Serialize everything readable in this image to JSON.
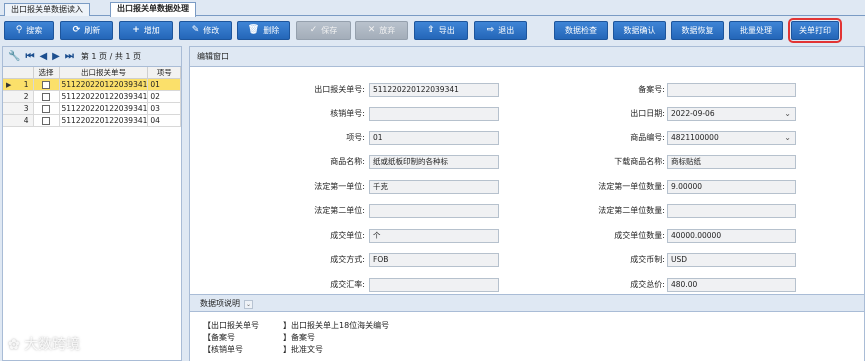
{
  "tabs": [
    {
      "label": "出口报关单数据读入"
    },
    {
      "label": "出口报关单数据处理"
    }
  ],
  "toolbar": {
    "search": {
      "label": "搜索",
      "icon": "search-icon"
    },
    "refresh": {
      "label": "刷新",
      "icon": "refresh-icon"
    },
    "add": {
      "label": "增加",
      "icon": "plus-icon"
    },
    "edit": {
      "label": "修改",
      "icon": "edit-icon"
    },
    "delete": {
      "label": "删除",
      "icon": "trash-icon"
    },
    "save": {
      "label": "保存",
      "icon": "check-icon"
    },
    "cancel": {
      "label": "放弃",
      "icon": "close-icon"
    },
    "export": {
      "label": "导出",
      "icon": "upload-icon"
    },
    "exit": {
      "label": "退出",
      "icon": "exit-icon"
    },
    "data_check": {
      "label": "数据检查"
    },
    "data_confirm": {
      "label": "数据确认"
    },
    "data_restore": {
      "label": "数据恢复"
    },
    "batch": {
      "label": "批量处理"
    },
    "print": {
      "label": "关单打印"
    }
  },
  "pager": {
    "info": "第 1 页 / 共 1 页"
  },
  "grid": {
    "headers": {
      "select": "选择",
      "no": "出口报关单号",
      "seq": "项号"
    },
    "rows": [
      {
        "rn": "1",
        "no": "511220220122039341",
        "seq": "01"
      },
      {
        "rn": "2",
        "no": "511220220122039341",
        "seq": "02"
      },
      {
        "rn": "3",
        "no": "511220220122039341",
        "seq": "03"
      },
      {
        "rn": "4",
        "no": "511220220122039341",
        "seq": "04"
      }
    ]
  },
  "edit_panel": {
    "title": "编辑窗口"
  },
  "form": {
    "decl_no": {
      "label": "出口报关单号:",
      "value": "511220220122039341"
    },
    "record_no": {
      "label": "备案号:",
      "value": ""
    },
    "verify_no": {
      "label": "核销单号:",
      "value": ""
    },
    "export_date": {
      "label": "出口日期:",
      "value": "2022-09-06"
    },
    "item_no": {
      "label": "项号:",
      "value": "01"
    },
    "goods_code": {
      "label": "商品编号:",
      "value": "4821100000"
    },
    "goods_name": {
      "label": "商品名称:",
      "value": "纸或纸板印制的各种标"
    },
    "dl_goods_name": {
      "label": "下载商品名称:",
      "value": "商标贴纸"
    },
    "unit1": {
      "label": "法定第一单位:",
      "value": "千克"
    },
    "qty1": {
      "label": "法定第一单位数量:",
      "value": "9.00000"
    },
    "unit2": {
      "label": "法定第二单位:",
      "value": ""
    },
    "qty2": {
      "label": "法定第二单位数量:",
      "value": ""
    },
    "deal_unit": {
      "label": "成交单位:",
      "value": "个"
    },
    "deal_qty": {
      "label": "成交单位数量:",
      "value": "40000.00000"
    },
    "deal_mode": {
      "label": "成交方式:",
      "value": "FOB"
    },
    "currency": {
      "label": "成交币制:",
      "value": "USD"
    },
    "rate": {
      "label": "成交汇率:",
      "value": ""
    },
    "total": {
      "label": "成交总价:",
      "value": "480.00"
    }
  },
  "description": {
    "title": "数据项说明",
    "rows": [
      {
        "key": "【出口报关单号",
        "val": "】出口报关单上18位海关编号"
      },
      {
        "key": "【备案号",
        "val": "】备案号"
      },
      {
        "key": "【核销单号",
        "val": "】批准文号"
      }
    ]
  },
  "watermark": "大数跨境",
  "colors": {
    "toolbar_button": "#2d74c8",
    "selected_row": "#fbe06a",
    "highlight_outline": "#e23434"
  }
}
